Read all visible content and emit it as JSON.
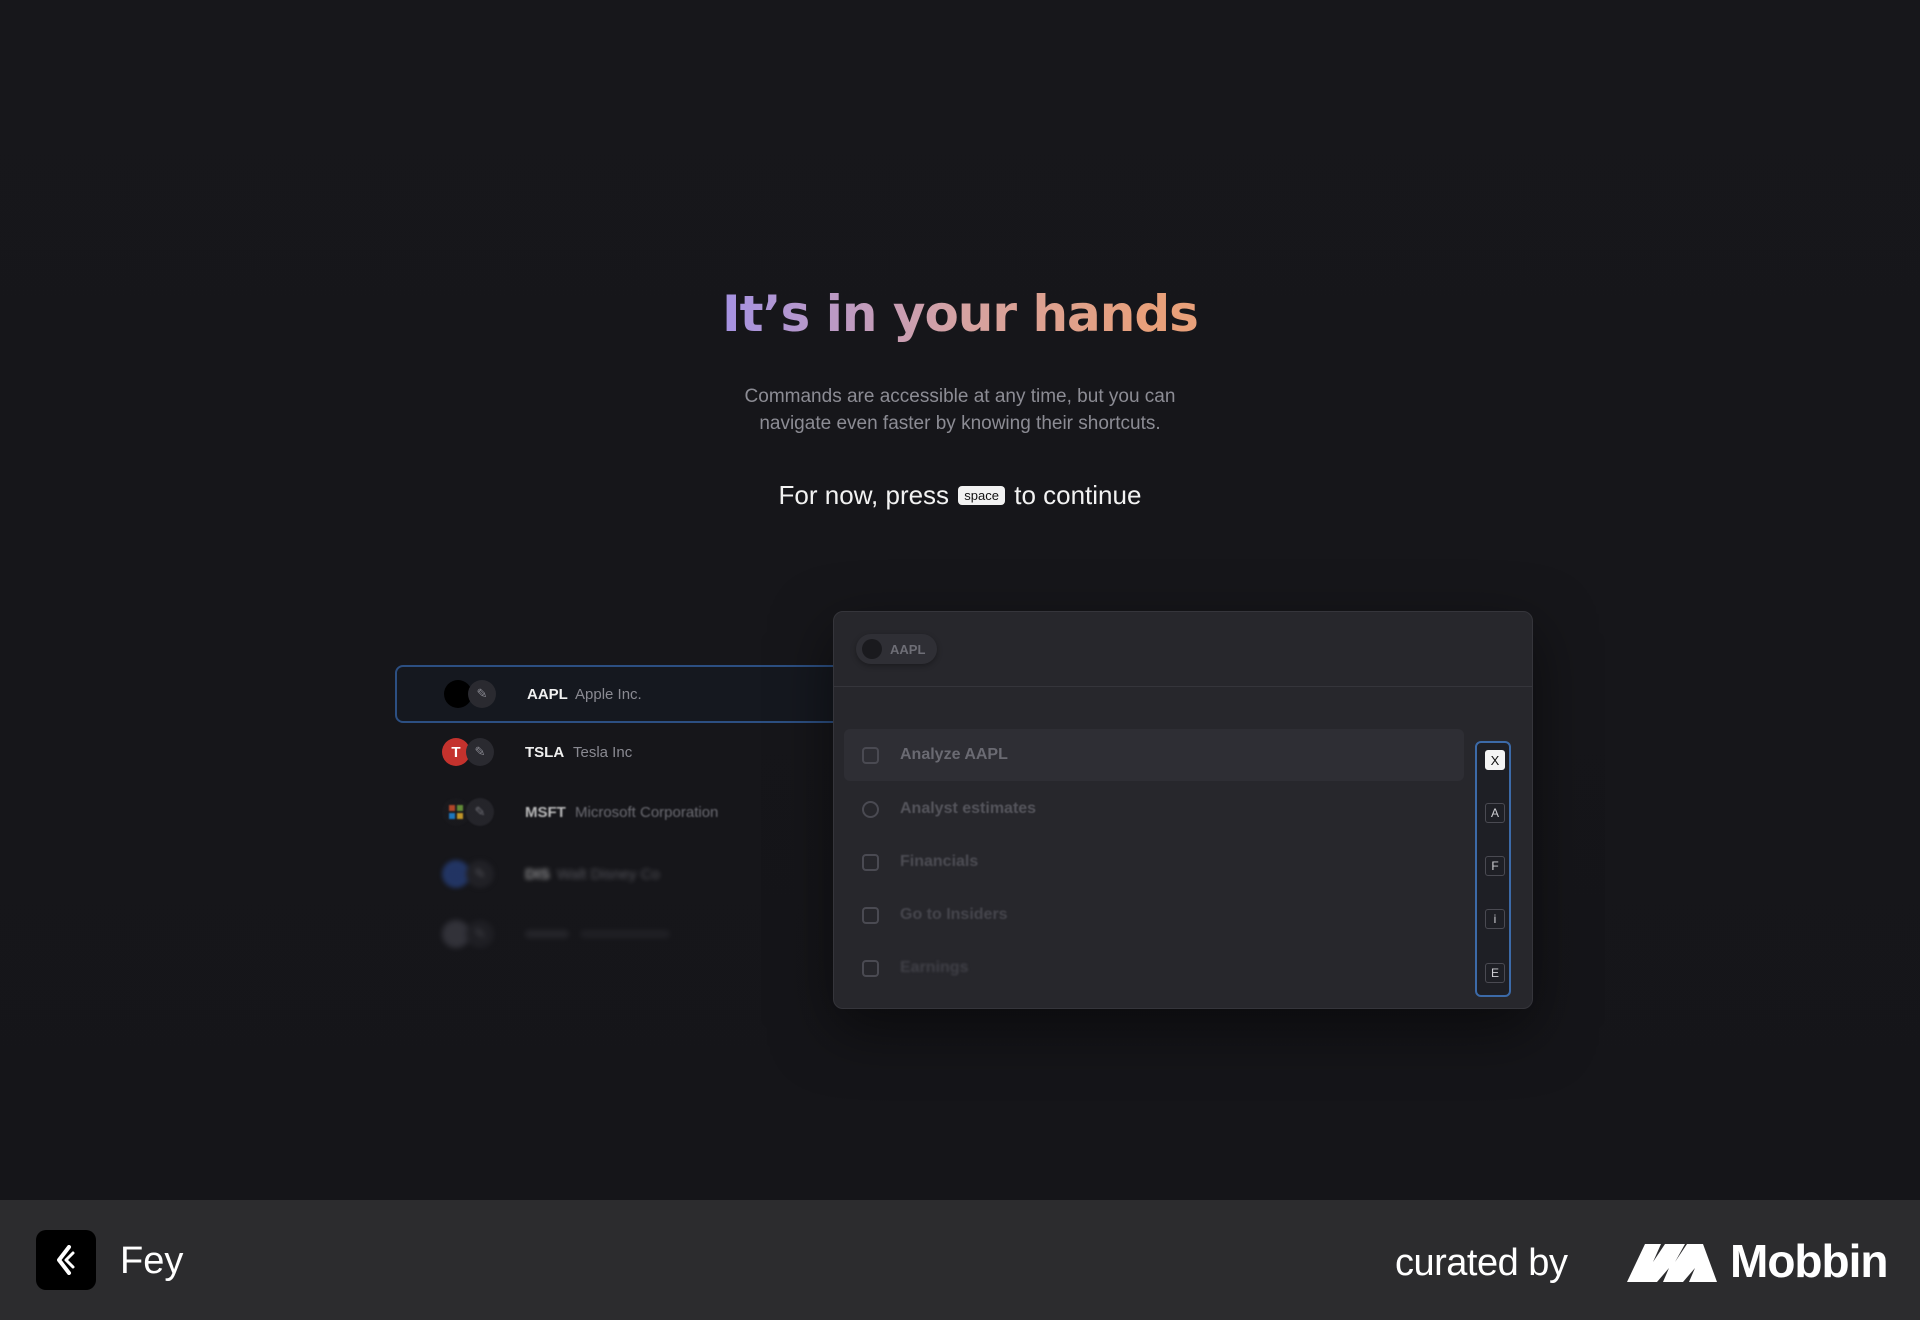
{
  "hero": {
    "title": "It’s in your hands",
    "subtitle_line1": "Commands are accessible at any time, but you can",
    "subtitle_line2": "navigate even faster by knowing their shortcuts.",
    "press_prefix": "For now, press",
    "press_key": "space",
    "press_suffix": "to continue"
  },
  "tickers": [
    {
      "symbol": "AAPL",
      "name": "Apple Inc.",
      "logo_icon": "apple-logo-icon",
      "logo_color": "#000000"
    },
    {
      "symbol": "TSLA",
      "name": "Tesla Inc",
      "logo_icon": "tesla-logo-icon",
      "logo_color": "#c4322d"
    },
    {
      "symbol": "MSFT",
      "name": "Microsoft Corporation",
      "logo_icon": "microsoft-logo-icon",
      "logo_color": "#1a1a1e"
    },
    {
      "symbol": "DIS",
      "name": "Walt Disney Co",
      "logo_icon": "disney-logo-icon",
      "logo_color": "#2d4fa0"
    },
    {
      "symbol": "",
      "name": "",
      "logo_icon": "company-logo-icon",
      "logo_color": "#555560"
    }
  ],
  "palette": {
    "chip_label": "AAPL",
    "section_label": "",
    "commands": [
      {
        "label": "Analyze AAPL",
        "shortcut": "X"
      },
      {
        "label": "Analyst estimates",
        "shortcut": "A"
      },
      {
        "label": "Financials",
        "shortcut": "F"
      },
      {
        "label": "Go to Insiders",
        "shortcut": "i"
      },
      {
        "label": "Earnings",
        "shortcut": "E"
      }
    ],
    "highlight_color": "#3c6aa8"
  },
  "footer": {
    "app_name": "Fey",
    "curated_by": "curated by",
    "brand": "Mobbin"
  }
}
